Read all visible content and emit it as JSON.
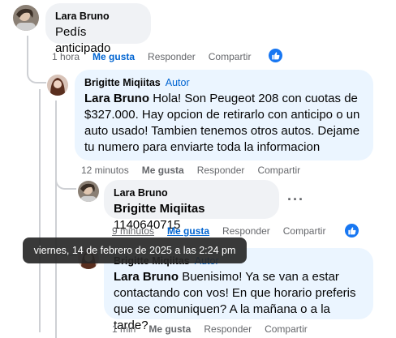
{
  "comments": [
    {
      "author": "Lara Bruno",
      "text": "Pedís anticipado",
      "time": "1 hora",
      "like": "Me gusta",
      "reply": "Responder",
      "share": "Compartir"
    },
    {
      "author": "Brigitte Miqiitas",
      "badge": "Autor",
      "mention": "Lara Bruno",
      "text": "Hola! Son Peugeot 208 con cuotas de $327.000. Hay opcion de retirarlo con anticipo o un auto usado! Tambien tenemos otros autos. Dejame tu numero para enviarte toda la informacion",
      "time": "12 minutos",
      "like": "Me gusta",
      "reply": "Responder",
      "share": "Compartir"
    },
    {
      "author": "Lara Bruno",
      "mention": "Brigitte Miqiitas",
      "text": "1140640715",
      "time": "9 minutos",
      "like": "Me gusta",
      "reply": "Responder",
      "share": "Compartir",
      "more": "···"
    },
    {
      "author": "Brigitte Miqiitas",
      "badge": "Autor",
      "mention": "Lara Bruno",
      "text": "Buenisimo! Ya se van a estar contactando con vos! En que horario preferis que se comuniquen? A la mañana o a la tarde?",
      "time": "1 min",
      "like": "Me gusta",
      "reply": "Responder",
      "share": "Compartir"
    }
  ],
  "tooltip": "viernes, 14 de febrero de 2025 a las 2:24 pm",
  "colors": {
    "accent": "#0064d1",
    "like_badge": "#1877f2",
    "bubble_grey": "#f0f2f5",
    "bubble_blue": "#ebf5ff"
  },
  "icons": {
    "like_reaction": "thumbs-up-icon"
  }
}
